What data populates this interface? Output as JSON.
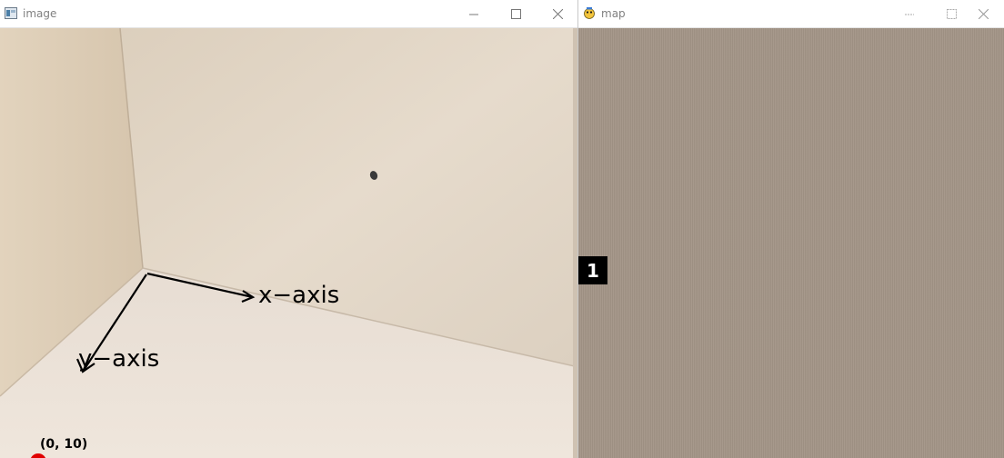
{
  "image_window": {
    "title": "image",
    "x_axis_label": "x−axis",
    "y_axis_label": "y−axis",
    "point_label": "(0, 10)"
  },
  "map_window": {
    "title": "map"
  },
  "step_badge": "1",
  "colors": {
    "map_background": "#a29486",
    "point_marker": "#e00000",
    "badge_background": "#000000"
  }
}
